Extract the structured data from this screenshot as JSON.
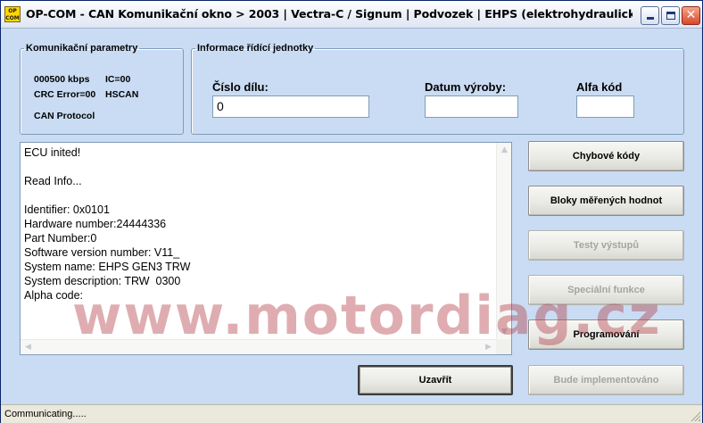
{
  "window": {
    "title": "OP-COM - CAN Komunikační okno > 2003 | Vectra-C / Signum | Podvozek | EHPS (elektrohydraulický posil. řízení)",
    "logo_text_top": "OP",
    "logo_text_bottom": "COM",
    "controls": {
      "minimize": "",
      "maximize": "",
      "close": "✕"
    }
  },
  "comm_params": {
    "legend": "Komunikační parametry",
    "baud": "000500 kbps",
    "ic": "IC=00",
    "crc": "CRC Error=00",
    "bus": "HSCAN",
    "protocol": "CAN Protocol"
  },
  "ecu_info": {
    "legend": "Informace řídící jednotky",
    "part_label": "Číslo dílu:",
    "part_value": "0",
    "date_label": "Datum výroby:",
    "date_value": "",
    "alpha_label": "Alfa kód",
    "alpha_value": ""
  },
  "log": {
    "text": "ECU inited!\n\nRead Info...\n\nIdentifier: 0x0101\nHardware number:24444336\nPart Number:0\nSoftware version number: V11_\nSystem name: EHPS GEN3 TRW\nSystem description: TRW  0300\nAlpha code:"
  },
  "buttons": {
    "error_codes": "Chybové kódy",
    "measured_blocks": "Bloky měřených hodnot",
    "output_tests": "Testy výstupů",
    "special_functions": "Speciální funkce",
    "programming": "Programování",
    "to_be_implemented": "Bude implementováno",
    "close": "Uzavřít"
  },
  "watermark": "www.motordiag.cz",
  "status": {
    "text": "Communicating....."
  },
  "colors": {
    "window_bg": "#c9dcf3",
    "watermark": "#b23c46",
    "disabled_text": "#a4a4a0"
  }
}
